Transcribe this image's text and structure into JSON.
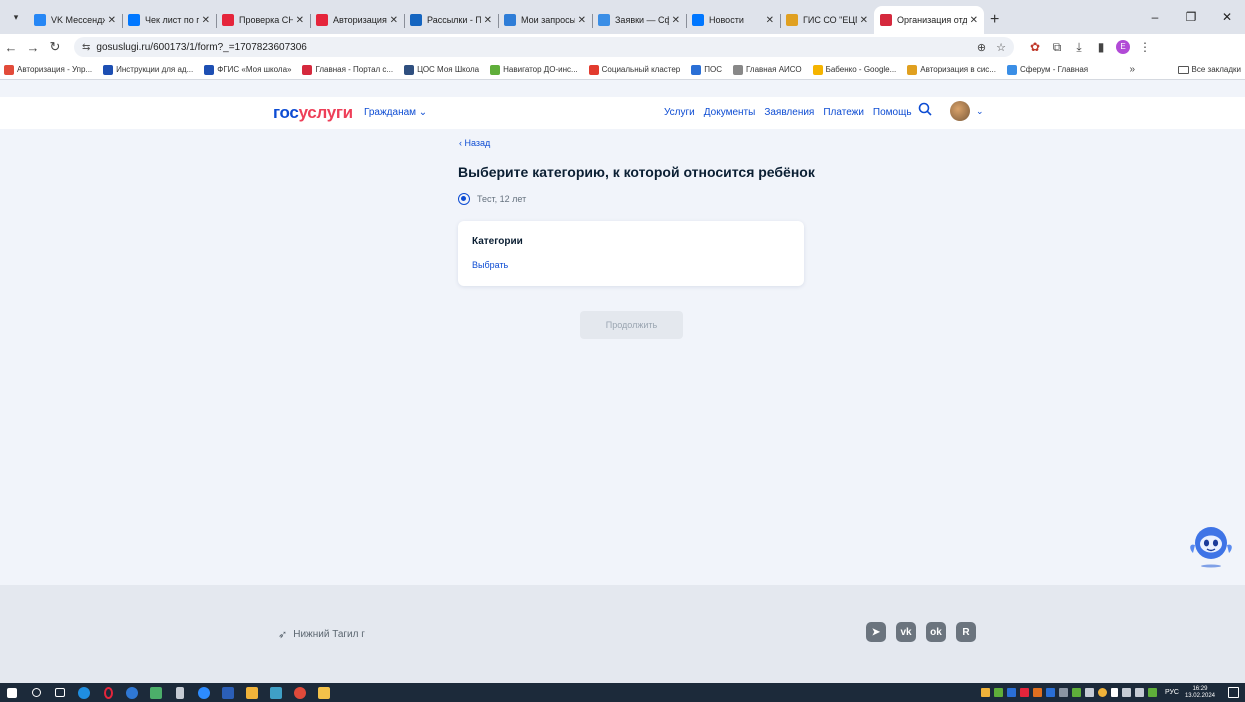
{
  "browser": {
    "tabs": [
      {
        "title": "VK Мессенджер",
        "color": "#2787f5"
      },
      {
        "title": "Чек лист по перс",
        "color": "#0077ff"
      },
      {
        "title": "Проверка СНИЛ",
        "color": "#e5253b"
      },
      {
        "title": "Авторизация по",
        "color": "#e5253b"
      },
      {
        "title": "Рассылки - Почт",
        "color": "#1565c0"
      },
      {
        "title": "Мои запросы - Т",
        "color": "#2e7dd7"
      },
      {
        "title": "Заявки — Сферу",
        "color": "#3a8ee6"
      },
      {
        "title": "Новости",
        "color": "#0077ff"
      },
      {
        "title": "ГИС СО \"ЕЦП\"",
        "color": "#e0a020"
      },
      {
        "title": "Организация отд",
        "color": "#d5293d",
        "active": true
      }
    ],
    "new_tab": "+",
    "url_site_icon": "⇆",
    "url": "gosuslugi.ru/600173/1/form?_=1707823607306",
    "profile_initial": "Е",
    "bookmarks": [
      {
        "label": "Авторизация - Упр...",
        "color": "#e24b3a"
      },
      {
        "label": "Инструкции для ад...",
        "color": "#1d4fb3"
      },
      {
        "label": "ФГИС «Моя школа»",
        "color": "#1d4fb3"
      },
      {
        "label": "Главная - Портал с...",
        "color": "#d5293d"
      },
      {
        "label": "ЦОС Моя Школа",
        "color": "#2f4f7f"
      },
      {
        "label": "Навигатор ДО-инс...",
        "color": "#5fae3a"
      },
      {
        "label": "Социальный кластер",
        "color": "#e23b2e"
      },
      {
        "label": "ПОС",
        "color": "#2a6fd6"
      },
      {
        "label": "Главная АИСО",
        "color": "#888888"
      },
      {
        "label": "Бабенко - Google...",
        "color": "#f5b400"
      },
      {
        "label": "Авторизация в сис...",
        "color": "#e0a020"
      },
      {
        "label": "Сферум - Главная",
        "color": "#3a8ee6"
      }
    ],
    "bookmarks_more": "»",
    "all_bookmarks": "Все закладки"
  },
  "site": {
    "logo_main": "гос",
    "logo_accent": "услуги",
    "citizens": "Гражданам ⌄",
    "nav": [
      "Услуги",
      "Документы",
      "Заявления",
      "Платежи",
      "Помощь"
    ]
  },
  "form": {
    "back": "‹ Назад",
    "title": "Выберите категорию, к которой относится ребёнок",
    "child": "Тест, 12 лет",
    "card_title": "Категории",
    "card_link": "Выбрать",
    "continue": "Продолжить"
  },
  "footer": {
    "city": "Нижний Тагил г",
    "socials": [
      "telegram",
      "vk",
      "ok",
      "rutube"
    ]
  },
  "taskbar": {
    "lang": "РУС",
    "time": "16:29",
    "date": "13.02.2024"
  }
}
